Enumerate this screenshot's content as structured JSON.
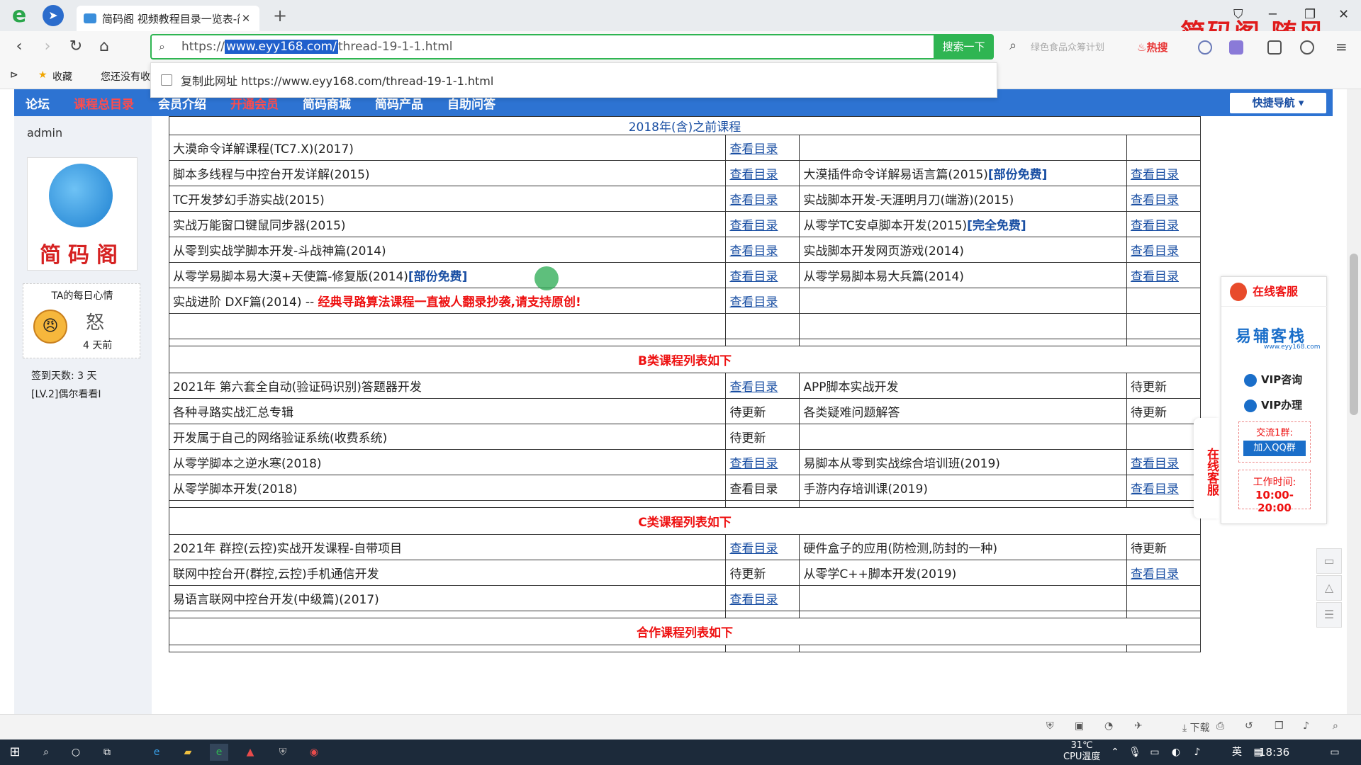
{
  "browser": {
    "tab_title": "简码阁 视频教程目录一览表-简码阁",
    "url_prefix": "https://",
    "url_selected": "www.eyy168.com/",
    "url_rest": "thread-19-1-1.html",
    "go_button": "搜索一下",
    "search_placeholder": "绿色食品众筹计划",
    "hot_label": "热搜",
    "brand_text": "简码阁 随风",
    "fav_collect": "收藏",
    "fav_item": "您还没有收",
    "dropdown_text": "复制此网址 https://www.eyy168.com/thread-19-1-1.html"
  },
  "site_nav": {
    "items": [
      "论坛",
      "课程总目录",
      "会员介绍",
      "开通会员",
      "简码商城",
      "简码产品",
      "自助问答"
    ],
    "quick_nav": "快捷导航"
  },
  "user": {
    "name": "admin",
    "logo_text": "简码阁",
    "mood_title": "TA的每日心情",
    "mood": "怒",
    "mood_time": "4 天前",
    "checkin": "签到天数: 3 天",
    "level": "[LV.2]偶尔看看I"
  },
  "courses": {
    "section_old": "2018年(含)之前课程",
    "old_rows": [
      [
        "大漠命令详解课程(TC7.X)(2017)",
        "查看目录",
        "",
        ""
      ],
      [
        "脚本多线程与中控台开发详解(2015)",
        "查看目录",
        "大漠插件命令详解易语言篇(2015)",
        "查看目录"
      ],
      [
        "TC开发梦幻手游实战(2015)",
        "查看目录",
        "实战脚本开发-天涯明月刀(端游)(2015)",
        "查看目录"
      ],
      [
        "实战万能窗口键鼠同步器(2015)",
        "查看目录",
        "从零学TC安卓脚本开发(2015)",
        "查看目录"
      ],
      [
        "从零到实战学脚本开发-斗战神篇(2014)",
        "查看目录",
        "实战脚本开发网页游戏(2014)",
        "查看目录"
      ],
      [
        "从零学易脚本易大漠+天使篇-修复版(2014)",
        "查看目录",
        "从零学易脚本易大兵篇(2014)",
        "查看目录"
      ],
      [
        "实战进阶 DXF篇(2014) -- ",
        "查看目录",
        "",
        ""
      ]
    ],
    "tag_partfree": "[部份免费]",
    "tag_free": "[完全免费]",
    "warn_text": "经典寻路算法课程一直被人翻录抄袭,请支持原创!",
    "section_b": "B类课程列表如下",
    "b_rows": [
      [
        "2021年 第六套全自动(验证码识别)答题器开发",
        "查看目录",
        "APP脚本实战开发",
        "待更新"
      ],
      [
        "各种寻路实战汇总专辑",
        "待更新",
        "各类疑难问题解答",
        "待更新"
      ],
      [
        "开发属于自己的网络验证系统(收费系统)",
        "待更新",
        "",
        ""
      ],
      [
        "从零学脚本之逆水寒(2018)",
        "查看目录",
        "易脚本从零到实战综合培训班(2019)",
        "查看目录"
      ],
      [
        "从零学脚本开发(2018)",
        "查看目录",
        "手游内存培训课(2019)",
        "查看目录"
      ]
    ],
    "section_c": "C类课程列表如下",
    "c_rows": [
      [
        "2021年 群控(云控)实战开发课程-自带项目",
        "查看目录",
        "硬件盒子的应用(防检测,防封的一种)",
        "待更新"
      ],
      [
        "联网中控台开(群控,云控)手机通信开发",
        "待更新",
        "从零学C++脚本开发(2019)",
        "查看目录"
      ],
      [
        "易语言联网中控台开发(中级篇)(2017)",
        "查看目录",
        "",
        ""
      ]
    ],
    "section_coop": "合作课程列表如下"
  },
  "service": {
    "title": "在线客服",
    "logo": "易辅客栈",
    "logo_sub": "www.eyy168.com",
    "vip1": "VIP咨询",
    "vip2": "VIP办理",
    "group": "交流1群:",
    "join_qq": "加入QQ群",
    "work_label": "工作时间:",
    "work_hours": "10:00-20:00",
    "side_tab": "在线客服"
  },
  "status": {
    "download": "下载"
  },
  "taskbar": {
    "temp": "31℃",
    "cpu": "CPU温度",
    "ime": "英",
    "clock": "18:36"
  }
}
